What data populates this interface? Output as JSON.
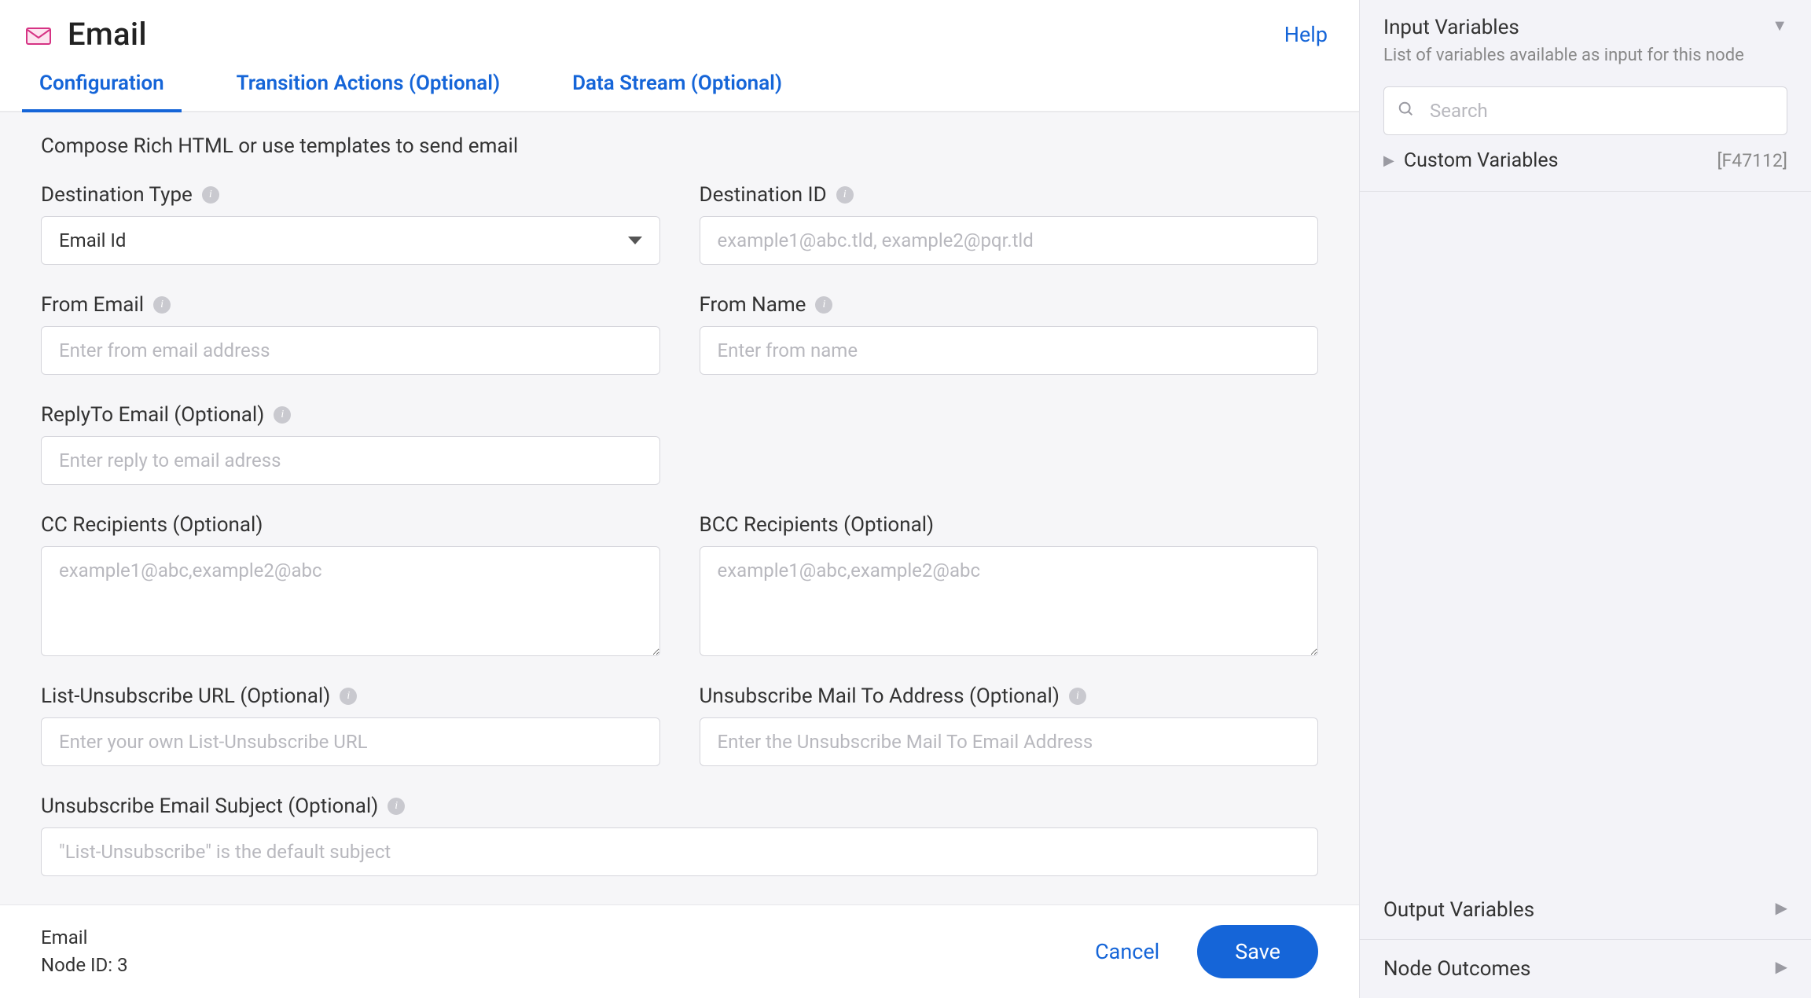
{
  "header": {
    "title": "Email",
    "help": "Help"
  },
  "tabs": [
    {
      "label": "Configuration",
      "active": true
    },
    {
      "label": "Transition Actions (Optional)",
      "active": false
    },
    {
      "label": "Data Stream (Optional)",
      "active": false
    }
  ],
  "body": {
    "compose_desc": "Compose Rich HTML or use templates to send email",
    "fields": {
      "destination_type": {
        "label": "Destination Type",
        "value": "Email Id",
        "info": true
      },
      "destination_id": {
        "label": "Destination ID",
        "placeholder": "example1@abc.tld, example2@pqr.tld",
        "info": true
      },
      "from_email": {
        "label": "From Email",
        "placeholder": "Enter from email address",
        "info": true
      },
      "from_name": {
        "label": "From Name",
        "placeholder": "Enter from name",
        "info": true
      },
      "reply_to": {
        "label": "ReplyTo Email (Optional)",
        "placeholder": "Enter reply to email adress",
        "info": true
      },
      "cc": {
        "label": "CC Recipients (Optional)",
        "placeholder": "example1@abc,example2@abc",
        "info": false
      },
      "bcc": {
        "label": "BCC Recipients (Optional)",
        "placeholder": "example1@abc,example2@abc",
        "info": false
      },
      "list_unsub_url": {
        "label": "List-Unsubscribe URL (Optional)",
        "placeholder": "Enter your own List-Unsubscribe URL",
        "info": true
      },
      "unsub_mailto": {
        "label": "Unsubscribe Mail To Address (Optional)",
        "placeholder": "Enter the Unsubscribe Mail To Email Address",
        "info": true
      },
      "unsub_subject": {
        "label": "Unsubscribe Email Subject (Optional)",
        "placeholder": "\"List-Unsubscribe\" is the default subject",
        "info": true
      }
    }
  },
  "footer": {
    "name": "Email",
    "node_id_label": "Node ID: 3",
    "cancel": "Cancel",
    "save": "Save"
  },
  "side": {
    "input_vars": {
      "title": "Input Variables",
      "desc": "List of variables available as input for this node",
      "search_placeholder": "Search",
      "tree": {
        "label": "Custom Variables",
        "tag": "[F47112]"
      }
    },
    "output_vars": {
      "title": "Output Variables"
    },
    "node_outcomes": {
      "title": "Node Outcomes"
    }
  }
}
